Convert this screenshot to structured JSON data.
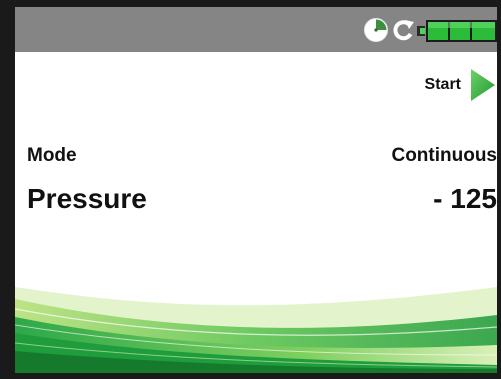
{
  "status_bar": {
    "icons": [
      "timer-icon",
      "refresh-icon",
      "battery-icon"
    ],
    "color": "#858585"
  },
  "controls": {
    "start_label": "Start",
    "start_icon": "play-icon"
  },
  "settings": {
    "mode_label": "Mode",
    "mode_value": "Continuous",
    "pressure_label": "Pressure",
    "pressure_value": "- 125"
  },
  "colors": {
    "accent": "#3cb64a",
    "status_bar": "#858585",
    "battery": "#2dbb3a"
  }
}
